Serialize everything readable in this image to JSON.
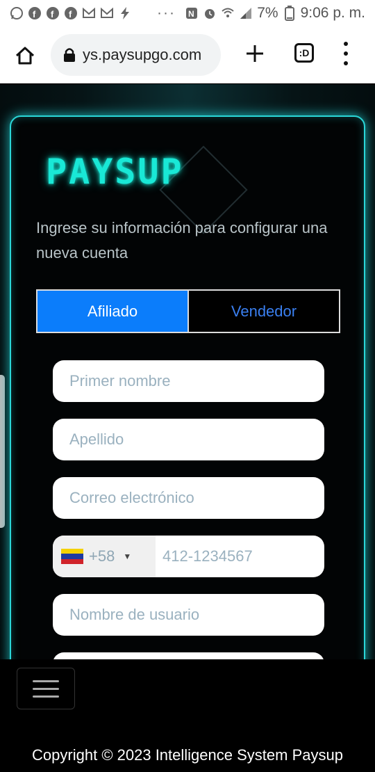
{
  "status_bar": {
    "dots": "···",
    "battery": "7%",
    "time": "9:06 p. m."
  },
  "browser": {
    "url": "ys.paysupgo.com",
    "tabs_count": ":D"
  },
  "brand": {
    "logo": "PAYSUP"
  },
  "form": {
    "intro": "Ingrese su información para configurar una nueva cuenta",
    "tabs": [
      {
        "label": "Afiliado",
        "active": true
      },
      {
        "label": "Vendedor",
        "active": false
      }
    ],
    "fields": {
      "first_name_placeholder": "Primer nombre",
      "last_name_placeholder": "Apellido",
      "email_placeholder": "Correo electrónico",
      "phone_code": "+58",
      "phone_placeholder": "412-1234567",
      "username_placeholder": "Nombre de usuario"
    }
  },
  "footer": {
    "copyright": "Copyright © 2023 Intelligence System Paysup"
  },
  "colors": {
    "accent_cyan": "#2ad7d8",
    "active_tab": "#0b7dfb",
    "inactive_tab_text": "#3a7ff0"
  }
}
